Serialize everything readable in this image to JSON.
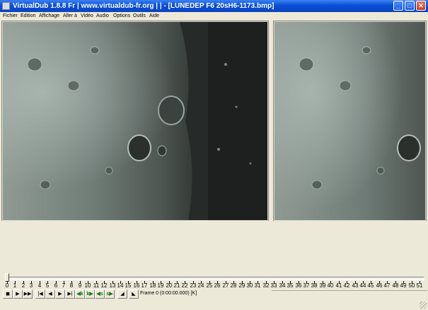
{
  "window": {
    "title": "VirtualDub 1.8.8 Fr | www.virtualdub-fr.org | | - [LUNEDEP F6 20sH6-1173.bmp]",
    "minimize_glyph": "_",
    "maximize_glyph": "□",
    "close_glyph": "✕"
  },
  "menu": [
    "Fichier",
    "Edition",
    "Affichage",
    "Aller à",
    "Vidéo",
    "Audio",
    "Options",
    "Outils",
    "Aide"
  ],
  "panes": {
    "input_label": "",
    "output_label": ""
  },
  "timeline": {
    "current_frame": 0,
    "total_frames": 51,
    "ticks": [
      "0",
      "1",
      "2",
      "3",
      "4",
      "5",
      "6",
      "7",
      "8",
      "9",
      "10",
      "11",
      "12",
      "13",
      "14",
      "15",
      "16",
      "17",
      "18",
      "19",
      "20",
      "21",
      "22",
      "23",
      "24",
      "25",
      "26",
      "27",
      "28",
      "29",
      "30",
      "31",
      "32",
      "33",
      "34",
      "35",
      "36",
      "37",
      "38",
      "39",
      "40",
      "41",
      "42",
      "43",
      "44",
      "45",
      "46",
      "47",
      "48",
      "49",
      "50",
      "51"
    ]
  },
  "toolbar": {
    "buttons": [
      {
        "name": "stop-button",
        "glyph": "◼",
        "style": ""
      },
      {
        "name": "play-input-button",
        "glyph": "▶",
        "style": ""
      },
      {
        "name": "play-output-button",
        "glyph": "▶▶",
        "style": ""
      },
      {
        "name": "go-start-button",
        "glyph": "|◀",
        "style": ""
      },
      {
        "name": "prev-frame-button",
        "glyph": "◀",
        "style": ""
      },
      {
        "name": "next-frame-button",
        "glyph": "▶",
        "style": ""
      },
      {
        "name": "go-end-button",
        "glyph": "▶|",
        "style": ""
      },
      {
        "name": "prev-key-button",
        "glyph": "◀k",
        "style": "green"
      },
      {
        "name": "next-key-button",
        "glyph": "k▶",
        "style": "green"
      },
      {
        "name": "scene-back-button",
        "glyph": "◀s",
        "style": "green"
      },
      {
        "name": "scene-fwd-button",
        "glyph": "s▶",
        "style": "green"
      },
      {
        "name": "mark-in-button",
        "glyph": "◢",
        "style": ""
      },
      {
        "name": "mark-out-button",
        "glyph": "◣",
        "style": ""
      }
    ],
    "frame_status": "Frame 0 (0:00:00.000) [K]"
  },
  "colors": {
    "title_gradient_top": "#3a81f3",
    "title_gradient_bottom": "#0c3fb0",
    "chrome": "#ece9d8"
  }
}
